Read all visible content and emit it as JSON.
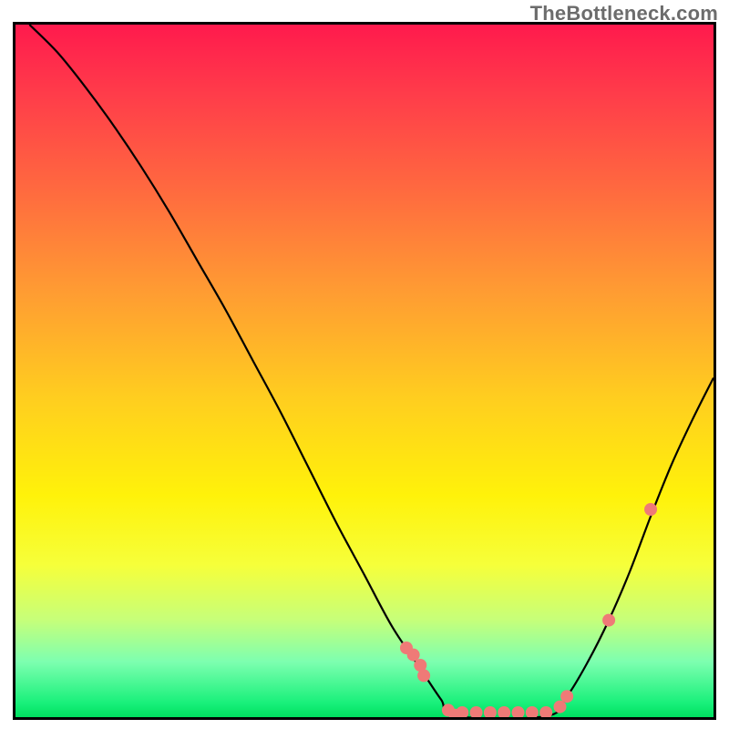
{
  "watermark": "TheBottleneck.com",
  "chart_data": {
    "type": "line",
    "title": "",
    "xlabel": "",
    "ylabel": "",
    "xlim": [
      0,
      100
    ],
    "ylim": [
      0,
      100
    ],
    "grid": false,
    "legend": false,
    "background_gradient": [
      "#ff1a4d",
      "#ff6a3f",
      "#ffce1f",
      "#f6ff3a",
      "#00e060"
    ],
    "series": [
      {
        "name": "curve-left",
        "x": [
          2,
          6,
          10,
          14,
          18,
          22,
          26,
          30,
          34,
          38,
          42,
          46,
          50,
          54,
          58,
          61,
          63
        ],
        "y": [
          100,
          96,
          91,
          85.5,
          79.5,
          73,
          66,
          59,
          51.5,
          44,
          36,
          28,
          20.5,
          13,
          7,
          2.5,
          0
        ]
      },
      {
        "name": "flat-bottom",
        "x": [
          63,
          76
        ],
        "y": [
          0,
          0
        ]
      },
      {
        "name": "curve-right",
        "x": [
          76,
          79,
          82,
          85,
          88,
          91,
          94,
          97,
          100
        ],
        "y": [
          0,
          3,
          8,
          14,
          21,
          29,
          36.5,
          43,
          49
        ]
      }
    ],
    "points": {
      "name": "highlight-dots",
      "color": "#ef7a77",
      "x": [
        56,
        57,
        58,
        58.5,
        62,
        63,
        64,
        66,
        68,
        70,
        72,
        74,
        76,
        78,
        79,
        85,
        91
      ],
      "y": [
        10,
        9,
        7.5,
        6,
        1,
        0.3,
        0,
        0,
        0,
        0,
        0,
        0,
        0,
        1.5,
        3,
        14,
        30
      ]
    }
  }
}
